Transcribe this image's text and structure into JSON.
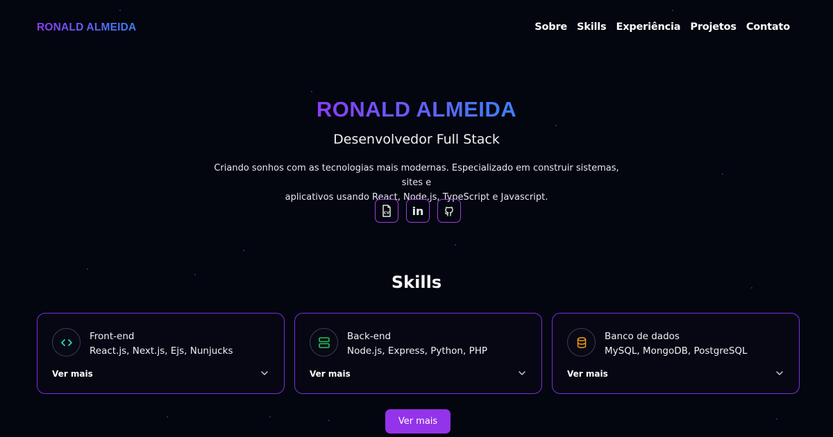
{
  "header": {
    "logo": "RONALD ALMEIDA",
    "nav": [
      "Sobre",
      "Skills",
      "Experiência",
      "Projetos",
      "Contato"
    ]
  },
  "hero": {
    "title": "RONALD ALMEIDA",
    "subtitle": "Desenvolvedor Full Stack",
    "description_line1": "Criando sonhos com as tecnologias mais modernas. Especializado em construir sistemas, sites e",
    "description_line2": "aplicativos usando React, Node.js, TypeScript e Javascript.",
    "socials": [
      {
        "icon": "cv-document-icon",
        "glyph": "CV"
      },
      {
        "icon": "linkedin-icon",
        "glyph": "in"
      },
      {
        "icon": "github-icon"
      }
    ]
  },
  "skills": {
    "title": "Skills",
    "cards": [
      {
        "title": "Front-end",
        "tech": "React.js, Next.js, Ejs, Nunjucks",
        "more": "Ver mais",
        "icon": "code-icon",
        "icon_color": "#2dd4bf"
      },
      {
        "title": "Back-end",
        "tech": "Node.js, Express, Python, PHP",
        "more": "Ver mais",
        "icon": "server-icon",
        "icon_color": "#22c55e"
      },
      {
        "title": "Banco de dados",
        "tech": "MySQL, MongoDB, PostgreSQL",
        "more": "Ver mais",
        "icon": "database-icon",
        "icon_color": "#f59e0b"
      }
    ],
    "more_button": "Ver mais"
  },
  "colors": {
    "background": "#03050f",
    "accent_purple": "#9333ea",
    "gradient_start": "#8b3cf6",
    "gradient_end": "#3b82f6"
  }
}
